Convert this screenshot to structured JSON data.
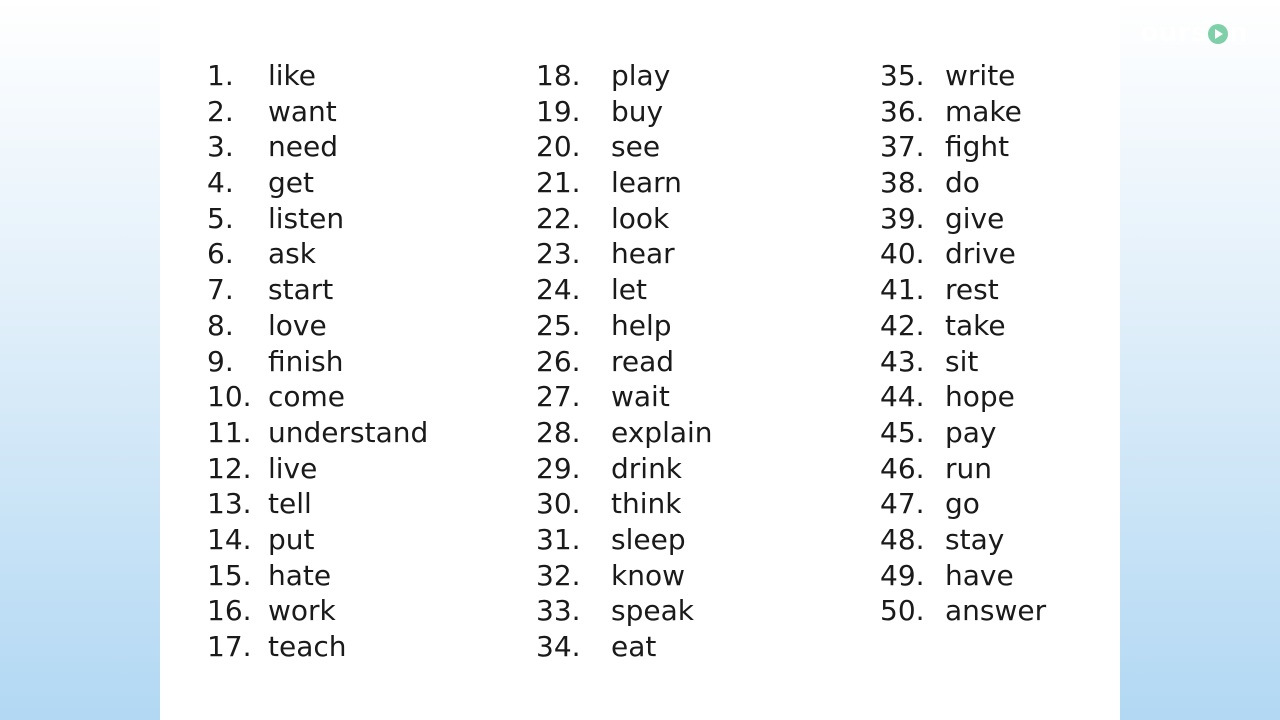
{
  "watermark": {
    "prefix": "ours",
    "suffix": "n"
  },
  "columns": [
    [
      {
        "n": "1.",
        "w": "like"
      },
      {
        "n": "2.",
        "w": "want"
      },
      {
        "n": "3.",
        "w": "need"
      },
      {
        "n": "4.",
        "w": "get"
      },
      {
        "n": "5.",
        "w": "listen"
      },
      {
        "n": "6.",
        "w": "ask"
      },
      {
        "n": "7.",
        "w": "start"
      },
      {
        "n": "8.",
        "w": "love"
      },
      {
        "n": "9.",
        "w": "finish"
      },
      {
        "n": "10.",
        "w": "come"
      },
      {
        "n": "11.",
        "w": "understand"
      },
      {
        "n": "12.",
        "w": "live"
      },
      {
        "n": "13.",
        "w": "tell"
      },
      {
        "n": "14.",
        "w": "put"
      },
      {
        "n": "15.",
        "w": "hate"
      },
      {
        "n": "16.",
        "w": "work"
      },
      {
        "n": "17.",
        "w": "teach"
      }
    ],
    [
      {
        "n": "18.",
        "w": "play"
      },
      {
        "n": "19.",
        "w": "buy"
      },
      {
        "n": "20.",
        "w": "see"
      },
      {
        "n": "21.",
        "w": "learn"
      },
      {
        "n": "22.",
        "w": "look"
      },
      {
        "n": "23.",
        "w": "hear"
      },
      {
        "n": "24.",
        "w": "let"
      },
      {
        "n": "25.",
        "w": "help"
      },
      {
        "n": "26.",
        "w": "read"
      },
      {
        "n": "27.",
        "w": "wait"
      },
      {
        "n": "28.",
        "w": "explain"
      },
      {
        "n": "29.",
        "w": "drink"
      },
      {
        "n": "30.",
        "w": "think"
      },
      {
        "n": "31.",
        "w": "sleep"
      },
      {
        "n": "32.",
        "w": "know"
      },
      {
        "n": "33.",
        "w": "speak"
      },
      {
        "n": "34.",
        "w": "eat"
      }
    ],
    [
      {
        "n": "35.",
        "w": "write"
      },
      {
        "n": "36.",
        "w": "make"
      },
      {
        "n": "37.",
        "w": "fight"
      },
      {
        "n": "38.",
        "w": "do"
      },
      {
        "n": "39.",
        "w": "give"
      },
      {
        "n": "40.",
        "w": "drive"
      },
      {
        "n": "41.",
        "w": "rest"
      },
      {
        "n": "42.",
        "w": "take"
      },
      {
        "n": "43.",
        "w": "sit"
      },
      {
        "n": "44.",
        "w": "hope"
      },
      {
        "n": "45.",
        "w": "pay"
      },
      {
        "n": "46.",
        "w": "run"
      },
      {
        "n": "47.",
        "w": "go"
      },
      {
        "n": "48.",
        "w": "stay"
      },
      {
        "n": "49.",
        "w": "have"
      },
      {
        "n": "50.",
        "w": "answer"
      }
    ]
  ]
}
